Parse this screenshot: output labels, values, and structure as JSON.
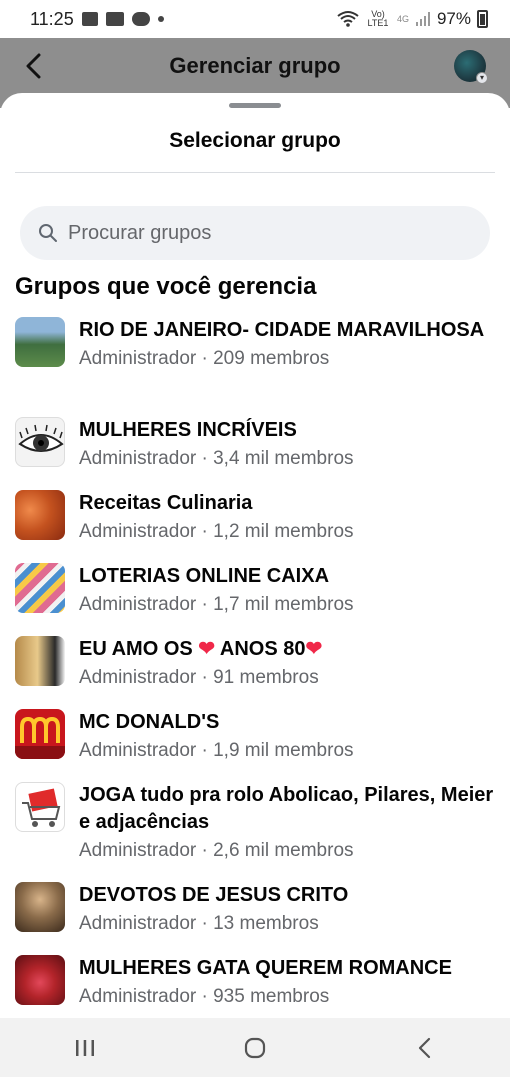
{
  "status_bar": {
    "time": "11:25",
    "network": "Vo) LTE1",
    "network_type": "4G",
    "battery": "97%"
  },
  "header": {
    "title": "Gerenciar grupo",
    "back_icon": "chevron-left-icon",
    "avatar_icon": "profile-avatar"
  },
  "sheet": {
    "title": "Selecionar grupo",
    "search_placeholder": "Procurar grupos",
    "section_heading": "Grupos que você gerencia"
  },
  "groups": [
    {
      "name": "RIO DE JANEIRO- CIDADE MARAVILHOSA",
      "meta": "Administrador · 209 membros",
      "thumb_color": "#4a7a56"
    },
    {
      "name": "MULHERES INCRÍVEIS",
      "meta": "Administrador · 3,4 mil membros",
      "thumb_color": "#e9e9e9"
    },
    {
      "name": "Receitas Culinaria",
      "meta": "Administrador · 1,2 mil membros",
      "thumb_color": "#c4521f"
    },
    {
      "name": "LOTERIAS ONLINE CAIXA",
      "meta": "Administrador · 1,7 mil membros",
      "thumb_color": "#d86a8f"
    },
    {
      "name": "EU AMO OS",
      "name_suffix": "ANOS 80",
      "meta": "Administrador · 91 membros",
      "thumb_color": "#d6b06a"
    },
    {
      "name": "MC DONALD'S",
      "meta": "Administrador · 1,9 mil membros",
      "thumb_color": "#cf1d1d"
    },
    {
      "name": "JOGA tudo pra rolo Abolicao, Pilares, Meier e adjacências",
      "meta": "Administrador · 2,6 mil membros",
      "thumb_color": "#ffffff"
    },
    {
      "name": "DEVOTOS DE JESUS CRITO",
      "meta": "Administrador · 13 membros",
      "thumb_color": "#8a6b4a"
    },
    {
      "name": "MULHERES GATA QUEREM ROMANCE",
      "meta": "Administrador · 935 membros",
      "thumb_color": "#b3242a"
    }
  ],
  "nav": {
    "recents_icon": "recents-icon",
    "home_icon": "home-icon",
    "back_icon": "back-icon"
  }
}
